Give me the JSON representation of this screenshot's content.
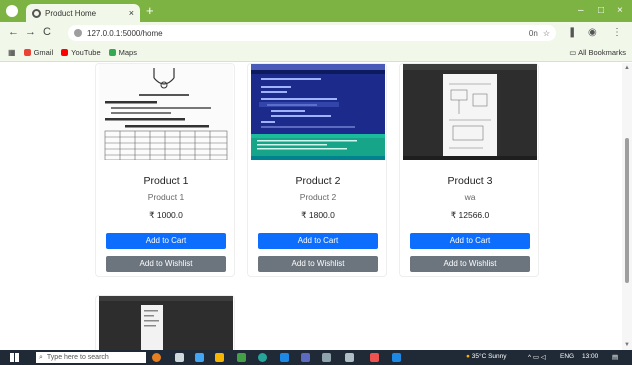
{
  "browser": {
    "tab_title": "Product Home",
    "tab_close": "×",
    "new_tab": "+",
    "window_controls": [
      "–",
      "□",
      "×"
    ],
    "nav": {
      "back": "←",
      "forward": "→",
      "reload": "C"
    },
    "url": "127.0.0.1:5000/home",
    "omnibox_icons": [
      "0n",
      "☆"
    ],
    "extension_icons": [
      "❚",
      "◉",
      "⋮"
    ],
    "bookmarks": [
      {
        "label": "Gmail",
        "color": "#ea4335"
      },
      {
        "label": "YouTube",
        "color": "#ff0000"
      },
      {
        "label": "Maps",
        "color": "#34a853"
      }
    ],
    "all_bookmarks": "All Bookmarks"
  },
  "products": [
    {
      "name": "Product 1",
      "description": "Product 1",
      "price": "₹ 1000.0",
      "add_to_cart": "Add to Cart",
      "add_to_wishlist": "Add to Wishlist",
      "thumbnail": "document-thumbnail"
    },
    {
      "name": "Product 2",
      "description": "Product 2",
      "price": "₹ 1800.0",
      "add_to_cart": "Add to Cart",
      "add_to_wishlist": "Add to Wishlist",
      "thumbnail": "code-editor-thumbnail"
    },
    {
      "name": "Product 3",
      "description": "wa",
      "price": "₹ 12566.0",
      "add_to_cart": "Add to Cart",
      "add_to_wishlist": "Add to Wishlist",
      "thumbnail": "desktop-document-thumbnail"
    }
  ],
  "taskbar": {
    "search_placeholder": "Type here to search",
    "weather": "35°C Sunny",
    "language": "ENG",
    "time": "13:00"
  },
  "colors": {
    "chrome_green": "#7cb342",
    "cart_button": "#0d6efd",
    "wishlist_button": "#6c757d"
  }
}
